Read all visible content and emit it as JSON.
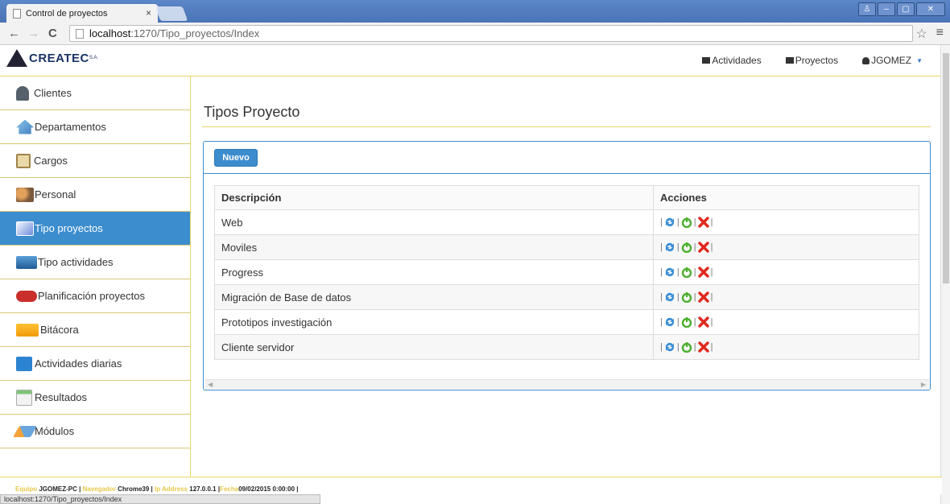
{
  "browser": {
    "tab_title": "Control de proyectos",
    "tab_close": "×",
    "url_host": "localhost",
    "url_path": ":1270/Tipo_proyectos/Index",
    "status_url": "localhost:1270/Tipo_proyectos/Index"
  },
  "brand": {
    "name": "CREATEC",
    "suffix": "S.A."
  },
  "navbar": {
    "activities": "Actividades",
    "projects": "Proyectos",
    "user": "JGOMEZ"
  },
  "sidebar": {
    "items": [
      {
        "label": "Clientes"
      },
      {
        "label": "Departamentos"
      },
      {
        "label": "Cargos"
      },
      {
        "label": "Personal"
      },
      {
        "label": "Tipo proyectos"
      },
      {
        "label": "Tipo actividades"
      },
      {
        "label": "Planificación proyectos"
      },
      {
        "label": "Bitácora"
      },
      {
        "label": "Actividades diarias"
      },
      {
        "label": "Resultados"
      },
      {
        "label": "Módulos"
      }
    ]
  },
  "main": {
    "title": "Tipos Proyecto",
    "new_button": "Nuevo",
    "table": {
      "headers": [
        "Descripción",
        "Acciones"
      ],
      "rows": [
        "Web",
        "Moviles",
        "Progress",
        "Migración de Base de datos",
        "Prototipos investigación",
        "Cliente servidor"
      ]
    }
  },
  "footer": {
    "k1": "Equipo",
    "v1": " JGOMEZ-PC | ",
    "k2": "Navegador",
    "v2": " Chrome39 | ",
    "k3": "Ip Address",
    "v3": " 127.0.0.1 |",
    "k4": "Fecha",
    "v4": "09/02/2015 0:00:00 |"
  },
  "colors": {
    "primary": "#3c8dce",
    "accent": "#e8d66a"
  }
}
